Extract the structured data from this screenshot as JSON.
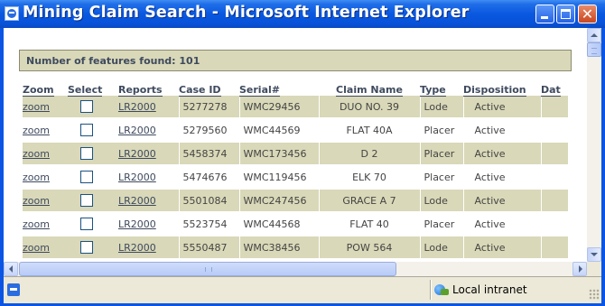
{
  "window": {
    "title": "Mining Claim Search - Microsoft Internet Explorer"
  },
  "summary": {
    "features_found": "Number of features found: 101"
  },
  "table": {
    "headers": [
      "Zoom",
      "Select",
      "Reports",
      "Case ID",
      "Serial#",
      "Claim Name",
      "Type",
      "Disposition",
      "Dat"
    ],
    "rows": [
      {
        "zoom": "zoom",
        "report": "LR2000",
        "case_id": "5277278",
        "serial": "WMC29456",
        "claim_name": "DUO NO. 39",
        "type": "Lode",
        "disposition": "Active"
      },
      {
        "zoom": "zoom",
        "report": "LR2000",
        "case_id": "5279560",
        "serial": "WMC44569",
        "claim_name": "FLAT 40A",
        "type": "Placer",
        "disposition": "Active"
      },
      {
        "zoom": "zoom",
        "report": "LR2000",
        "case_id": "5458374",
        "serial": "WMC173456",
        "claim_name": "D 2",
        "type": "Placer",
        "disposition": "Active"
      },
      {
        "zoom": "zoom",
        "report": "LR2000",
        "case_id": "5474676",
        "serial": "WMC119456",
        "claim_name": "ELK 70",
        "type": "Placer",
        "disposition": "Active"
      },
      {
        "zoom": "zoom",
        "report": "LR2000",
        "case_id": "5501084",
        "serial": "WMC247456",
        "claim_name": "GRACE A 7",
        "type": "Lode",
        "disposition": "Active"
      },
      {
        "zoom": "zoom",
        "report": "LR2000",
        "case_id": "5523754",
        "serial": "WMC44568",
        "claim_name": "FLAT 40",
        "type": "Placer",
        "disposition": "Active"
      },
      {
        "zoom": "zoom",
        "report": "LR2000",
        "case_id": "5550487",
        "serial": "WMC38456",
        "claim_name": "POW 564",
        "type": "Lode",
        "disposition": "Active"
      }
    ]
  },
  "status": {
    "zone": "Local intranet"
  },
  "colors": {
    "titlebar": "#0a55e4",
    "row_shade": "#d9d8b8",
    "link": "#3e4a5e"
  }
}
